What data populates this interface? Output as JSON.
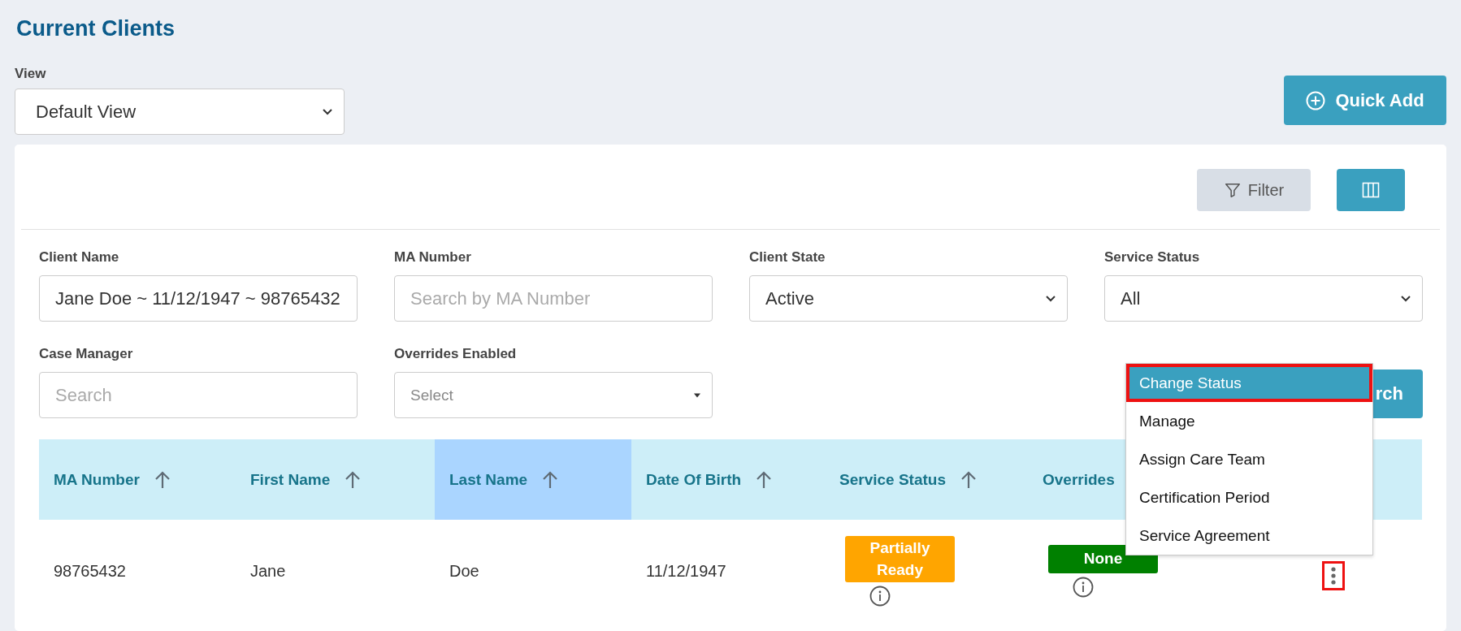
{
  "page_title": "Current Clients",
  "view": {
    "label": "View",
    "value": "Default View"
  },
  "quick_add": {
    "label": "Quick Add"
  },
  "toolbar": {
    "filter": "Filter"
  },
  "filters": [
    {
      "label": "Client Name",
      "kind": "text",
      "value": "Jane Doe ~ 11/12/1947 ~ 98765432"
    },
    {
      "label": "MA Number",
      "kind": "text",
      "placeholder": "Search by MA Number"
    },
    {
      "label": "Client State",
      "kind": "select",
      "value": "Active"
    },
    {
      "label": "Service Status",
      "kind": "select",
      "value": "All"
    },
    {
      "label": "Case Manager",
      "kind": "text",
      "placeholder": "Search"
    },
    {
      "label": "Overrides Enabled",
      "kind": "combo",
      "placeholder": "Select"
    }
  ],
  "search_button": {
    "label": "rch"
  },
  "table": {
    "columns": [
      {
        "label": "MA Number",
        "highlighted": false
      },
      {
        "label": "First Name",
        "highlighted": false
      },
      {
        "label": "Last Name",
        "highlighted": true
      },
      {
        "label": "Date Of Birth",
        "highlighted": false
      },
      {
        "label": "Service Status",
        "highlighted": false
      },
      {
        "label": "Overrides",
        "highlighted": false
      }
    ],
    "rows": [
      {
        "ma_number": "98765432",
        "first_name": "Jane",
        "last_name": "Doe",
        "date_of_birth": "11/12/1947",
        "service_status": {
          "label": "Partially Ready",
          "color": "#ffa500"
        },
        "overrides": {
          "label": "None",
          "color": "#008000"
        },
        "actions_annotated": true
      }
    ]
  },
  "action_menu": {
    "items": [
      {
        "label": "Change Status",
        "selected": true,
        "annotated": true
      },
      {
        "label": "Manage",
        "selected": false,
        "annotated": false
      },
      {
        "label": "Assign Care Team",
        "selected": false,
        "annotated": false
      },
      {
        "label": "Certification Period",
        "selected": false,
        "annotated": false
      },
      {
        "label": "Service Agreement",
        "selected": false,
        "annotated": false
      }
    ]
  }
}
